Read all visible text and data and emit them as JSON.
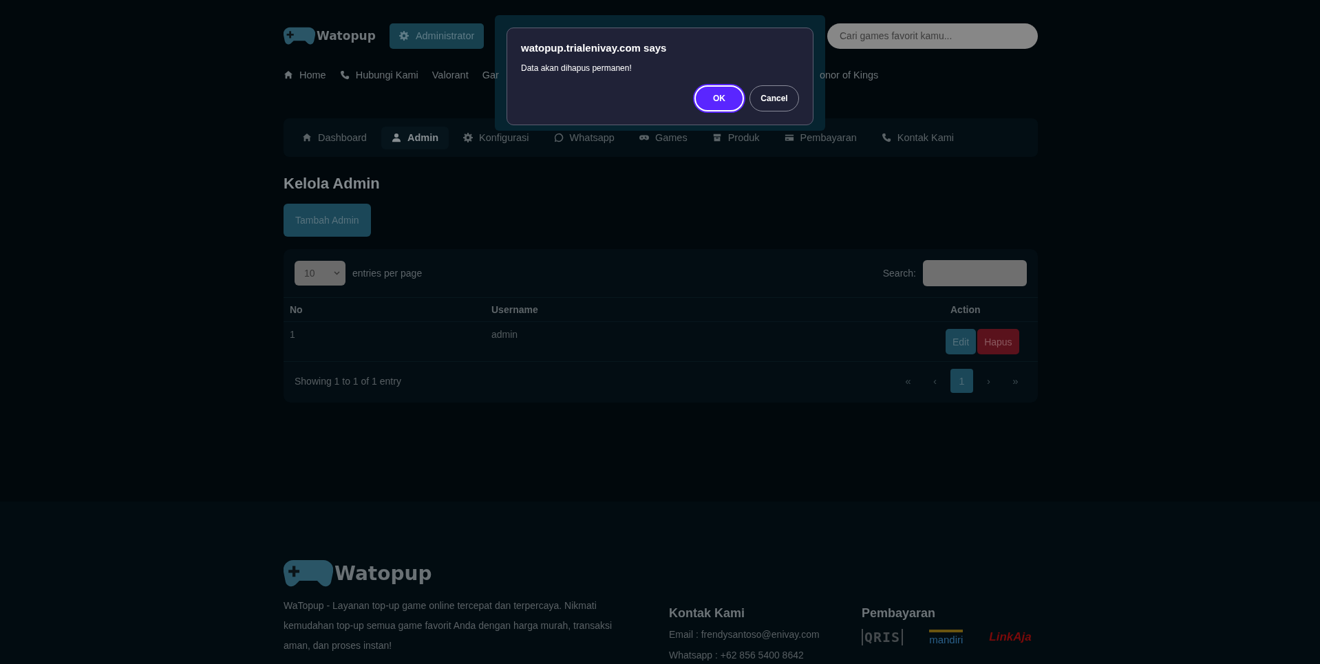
{
  "header": {
    "logo": "Watopup",
    "role_button": "Administrator",
    "search": {
      "placeholder": "Cari games favorit kamu..."
    }
  },
  "nav": [
    {
      "label": "Home"
    },
    {
      "label": "Hubungi Kami"
    },
    {
      "label": "Valorant"
    },
    {
      "label": "Gar"
    },
    {
      "label": "onor of Kings"
    }
  ],
  "dialog": {
    "title": "watopup.trialenivay.com says",
    "message": "Data akan dihapus permanen!",
    "buttons": [
      {
        "label": "OK",
        "kind": "primary"
      },
      {
        "label": "Cancel",
        "kind": "secondary"
      }
    ]
  },
  "admin_nav": [
    {
      "label": "Dashboard",
      "selected": false
    },
    {
      "label": "Admin",
      "selected": true
    },
    {
      "label": "Konfigurasi",
      "selected": false
    },
    {
      "label": "Whatsapp",
      "selected": false
    },
    {
      "label": "Games",
      "selected": false
    },
    {
      "label": "Produk",
      "selected": false
    },
    {
      "label": "Pembayaran",
      "selected": false
    },
    {
      "label": "Kontak Kami",
      "selected": false
    }
  ],
  "page_title": "Kelola Admin",
  "add_button": "Tambah Admin",
  "table": {
    "length_value": "10",
    "length_label": "entries per page",
    "search_label": "Search:",
    "columns": [
      "No",
      "Username",
      "Action"
    ],
    "rows": [
      {
        "no": "1",
        "username": "admin",
        "actions": [
          {
            "label": "Edit",
            "kind": "edit"
          },
          {
            "label": "Hapus",
            "kind": "delete"
          }
        ]
      }
    ],
    "info": "Showing 1 to 1 of 1 entry",
    "pagination": [
      {
        "label": "«",
        "selected": false
      },
      {
        "label": "‹",
        "selected": false
      },
      {
        "label": "1",
        "selected": true
      },
      {
        "label": "›",
        "selected": false
      },
      {
        "label": "»",
        "selected": false
      }
    ]
  },
  "footer": {
    "logo": "Watopup",
    "description": "WaTopup - Layanan top-up game online tercepat dan terpercaya. Nikmati kemudahan top-up semua game favorit Anda dengan harga murah, transaksi aman, dan proses instan!",
    "contact": {
      "title": "Kontak Kami",
      "lines": [
        "Email : frendysantoso@enivay.com",
        "Whatsapp : +62 856 5400 8642"
      ]
    },
    "payment": {
      "title": "Pembayaran",
      "logos": [
        {
          "label": "QRIS",
          "kind": "qris"
        },
        {
          "label": "mandiri",
          "kind": "mandiri"
        },
        {
          "label": "LinkAja",
          "kind": "linkaja"
        }
      ]
    }
  }
}
